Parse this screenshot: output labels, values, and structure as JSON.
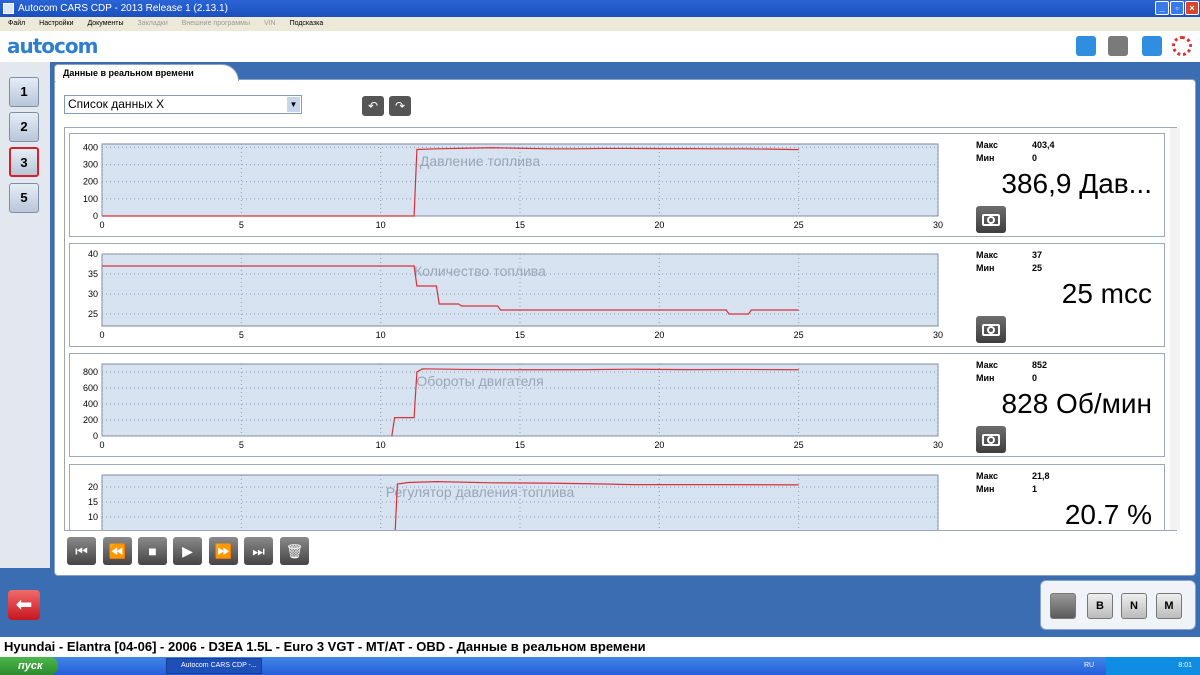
{
  "window": {
    "title": "Autocom CARS CDP - 2013 Release 1 (2.13.1)"
  },
  "menu": {
    "items": [
      "Файл",
      "Настройки",
      "Документы",
      "Закладки",
      "Внешние программы",
      "VIN",
      "Подсказка"
    ]
  },
  "logo": {
    "text": "autocom"
  },
  "toolbar": {
    "icons": [
      "info-icon",
      "obd-icon",
      "help-icon",
      "power-icon"
    ]
  },
  "nav": {
    "items": [
      {
        "label": "1"
      },
      {
        "label": "2"
      },
      {
        "label": "3",
        "active": true
      },
      {
        "label": "5"
      }
    ]
  },
  "tab": {
    "label": "Данные в реальном времени"
  },
  "list_select": {
    "value": "Список данных X"
  },
  "status": {
    "vehicle": "Hyundai - Elantra [04-06] - 2006 - D3EA 1.5L - Euro 3 VGT - MT/AT - OBD - Данные в реальном времени"
  },
  "right_buttons": [
    "B",
    "N",
    "M"
  ],
  "taskbar": {
    "start": "пуск",
    "task": "Autocom CARS CDP -...",
    "lang": "RU",
    "clock": "8:01"
  },
  "labels": {
    "max": "Макс",
    "min": "Мин"
  },
  "colors": {
    "plot_bg": "#d7e3f0",
    "trace": "#d6323c",
    "accent": "#2f7fd0"
  },
  "chart_data": [
    {
      "type": "line",
      "title": "Давление топлива",
      "stat_max": "403,4",
      "stat_min": "0",
      "display": "386,9 Дав...",
      "xlim": [
        0,
        30
      ],
      "ylim": [
        0,
        420
      ],
      "xticks": [
        0,
        5,
        10,
        15,
        20,
        25,
        30
      ],
      "yticks": [
        0,
        100,
        200,
        300,
        400
      ],
      "grid": true,
      "x": [
        0,
        11.2,
        11.3,
        12,
        13,
        14,
        15,
        16,
        17,
        18,
        19,
        20,
        21,
        22,
        23,
        24,
        25
      ],
      "y": [
        0,
        0,
        388,
        392,
        395,
        398,
        395,
        392,
        392,
        394,
        394,
        393,
        393,
        392,
        392,
        390,
        387
      ]
    },
    {
      "type": "line",
      "title": "Количество топлива",
      "stat_max": "37",
      "stat_min": "25",
      "display": "25 mcc",
      "xlim": [
        0,
        30
      ],
      "ylim": [
        22,
        40
      ],
      "xticks": [
        0,
        5,
        10,
        15,
        20,
        25,
        30
      ],
      "yticks": [
        25,
        30,
        35,
        40
      ],
      "grid": true,
      "x": [
        0,
        11.2,
        11.3,
        12,
        12.1,
        12.8,
        12.9,
        14.2,
        14.3,
        22.4,
        22.5,
        23.2,
        23.3,
        25
      ],
      "y": [
        37,
        37,
        32,
        32,
        27.5,
        27.5,
        27,
        27,
        26,
        26,
        25,
        25,
        26,
        26
      ]
    },
    {
      "type": "line",
      "title": "Обороты двигателя",
      "stat_max": "852",
      "stat_min": "0",
      "display": "828 Об/мин",
      "xlim": [
        0,
        30
      ],
      "ylim": [
        0,
        900
      ],
      "xticks": [
        0,
        5,
        10,
        15,
        20,
        25,
        30
      ],
      "yticks": [
        0,
        200,
        400,
        600,
        800
      ],
      "grid": true,
      "x": [
        10.4,
        10.5,
        11.2,
        11.3,
        11.5,
        13,
        15,
        17,
        19,
        21,
        23,
        25
      ],
      "y": [
        0,
        230,
        230,
        800,
        840,
        832,
        828,
        828,
        835,
        830,
        832,
        828
      ]
    },
    {
      "type": "line",
      "title": "Регулятор давления топлива",
      "stat_max": "21,8",
      "stat_min": "1",
      "display": "20.7 %",
      "xlim": [
        0,
        30
      ],
      "ylim": [
        0,
        24
      ],
      "xticks": [
        0,
        5,
        10,
        15,
        20,
        25,
        30
      ],
      "yticks": [
        10,
        15,
        20
      ],
      "grid": true,
      "x": [
        10.5,
        10.6,
        11,
        12,
        14,
        16,
        18,
        19,
        20,
        22,
        25
      ],
      "y": [
        1,
        21,
        21.5,
        21.8,
        21.4,
        21.3,
        21,
        20.8,
        20.8,
        20.8,
        20.7
      ]
    }
  ]
}
